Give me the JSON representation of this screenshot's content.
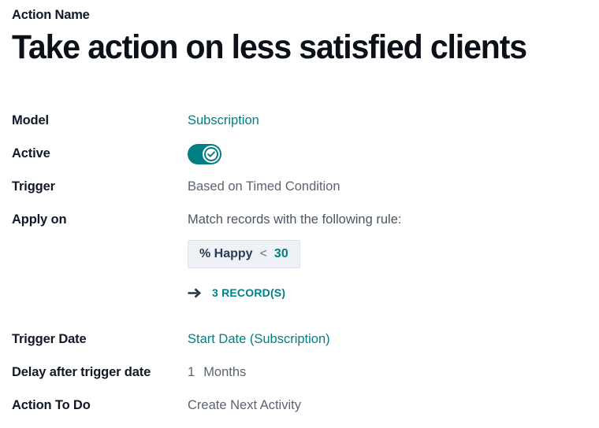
{
  "header": {
    "field_label": "Action Name",
    "title": "Take action on less satisfied clients"
  },
  "form": {
    "model": {
      "label": "Model",
      "value": "Subscription"
    },
    "active": {
      "label": "Active",
      "state": "on",
      "icon": "check-icon"
    },
    "trigger": {
      "label": "Trigger",
      "value": "Based on Timed Condition"
    },
    "apply_on": {
      "label": "Apply on",
      "match_text": "Match records with the following rule:",
      "rule": {
        "field": "% Happy",
        "operator": "<",
        "value": "30"
      },
      "records_link": {
        "icon": "arrow-right-icon",
        "text": "3 RECORD(S)"
      }
    },
    "trigger_date": {
      "label": "Trigger Date",
      "value": "Start Date (Subscription)"
    },
    "delay": {
      "label": "Delay after trigger date",
      "amount": "1",
      "unit": "Months"
    },
    "action_to_do": {
      "label": "Action To Do",
      "value": "Create Next Activity"
    }
  },
  "colors": {
    "accent_teal": "#017e84",
    "title_dark": "#0c1018",
    "value_gray": "#4b5563",
    "chip_bg": "#eef1f5",
    "chip_border": "#dfe3e9"
  }
}
